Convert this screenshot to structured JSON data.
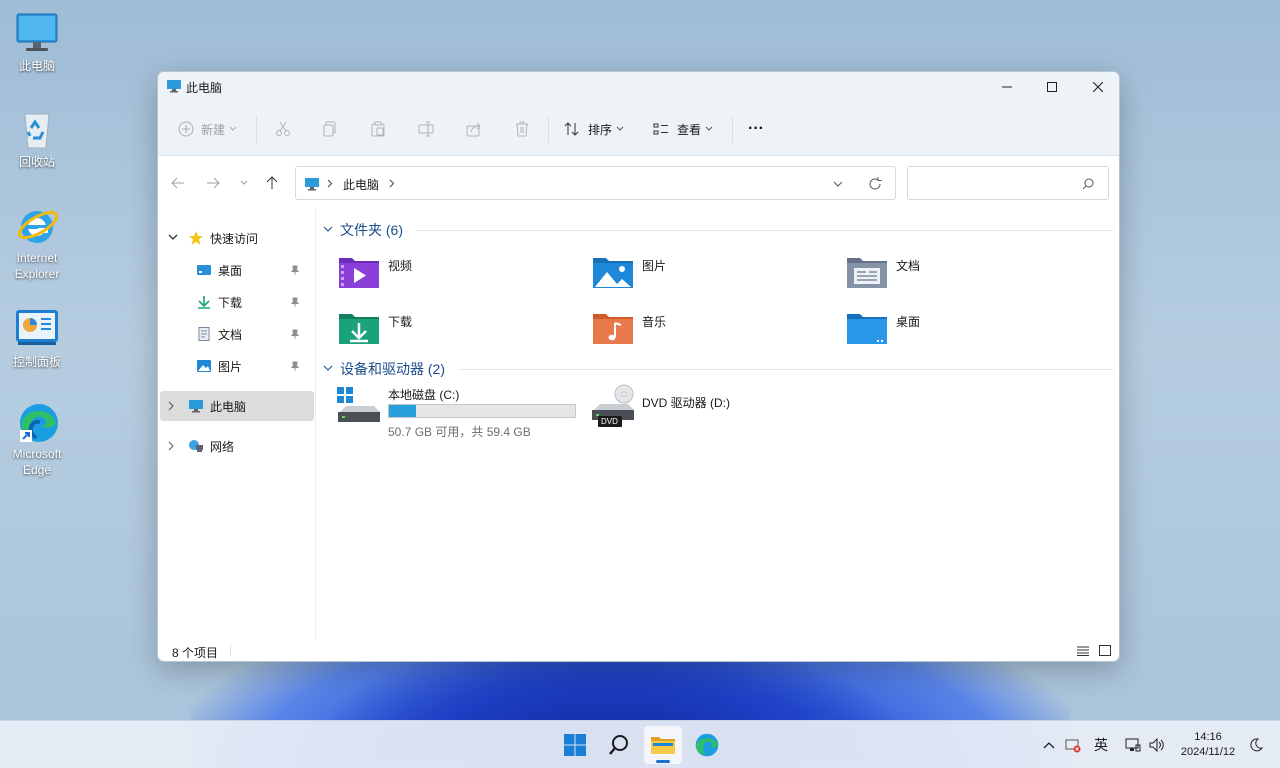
{
  "desktop": {
    "icons": [
      {
        "label": "此电脑",
        "icon": "this-pc-icon"
      },
      {
        "label": "回收站",
        "icon": "recycle-bin-icon"
      },
      {
        "label": "Internet Explorer",
        "icon": "internet-explorer-icon"
      },
      {
        "label": "控制面板",
        "icon": "control-panel-icon"
      },
      {
        "label": "Microsoft Edge",
        "icon": "edge-icon"
      }
    ]
  },
  "window": {
    "title": "此电脑",
    "toolbar": {
      "new_label": "新建",
      "sort_label": "排序",
      "view_label": "查看",
      "more_label": "···"
    },
    "address": {
      "path": "此电脑",
      "search_placeholder": ""
    },
    "sidebar": {
      "quick_access": "快速访问",
      "pinned": [
        {
          "label": "桌面"
        },
        {
          "label": "下载"
        },
        {
          "label": "文档"
        },
        {
          "label": "图片"
        }
      ],
      "this_pc": "此电脑",
      "network": "网络"
    },
    "groups": {
      "folders_header": "文件夹 (6)",
      "folders": [
        {
          "label": "视频",
          "color": "#8b3fd9"
        },
        {
          "label": "图片",
          "color": "#1e88d8"
        },
        {
          "label": "文档",
          "color": "#7c8aa0"
        },
        {
          "label": "下载",
          "color": "#1aa37a"
        },
        {
          "label": "音乐",
          "color": "#e2713e"
        },
        {
          "label": "桌面",
          "color": "#1f8fe0"
        }
      ],
      "drives_header": "设备和驱动器 (2)",
      "drives": [
        {
          "label": "本地磁盘 (C:)",
          "detail": "50.7 GB 可用，共 59.4 GB",
          "used_fraction": 0.146
        },
        {
          "label": "DVD 驱动器 (D:)",
          "badge": "DVD"
        }
      ]
    },
    "status": {
      "item_count": "8 个项目"
    }
  },
  "taskbar": {
    "ime": "英",
    "time": "14:16",
    "date": "2024/11/12"
  }
}
